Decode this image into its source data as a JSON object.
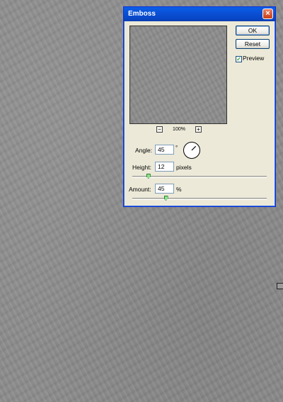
{
  "dialog": {
    "title": "Emboss",
    "close_glyph": "×",
    "ok_label": "OK",
    "reset_label": "Reset",
    "preview_label": "Preview",
    "preview_checked": true,
    "zoom": "100%",
    "zoom_out_glyph": "−",
    "zoom_in_glyph": "+",
    "angle_label": "Angle:",
    "angle_value": "45",
    "angle_unit": "°",
    "height_label": "Height:",
    "height_value": "12",
    "height_unit": "pixels",
    "amount_label": "Amount:",
    "amount_value": "45",
    "amount_unit": "%",
    "height_slider_fraction": 0.12,
    "amount_slider_fraction": 0.25,
    "dial_angle_deg": 45
  },
  "colors": {
    "titlebar": "#0a4fd4",
    "close_button": "#d8542e",
    "dialog_bg": "#ece9d8",
    "canvas": "#8b8b8b"
  },
  "icons": {
    "close": "close-icon",
    "zoom_out": "zoom-out-icon",
    "zoom_in": "zoom-in-icon",
    "checkmark": "checkmark-icon",
    "angle_dial": "angle-dial-icon"
  }
}
